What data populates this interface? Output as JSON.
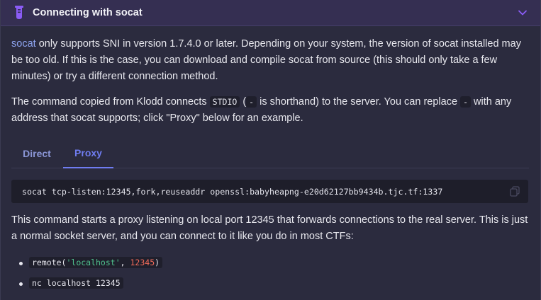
{
  "header": {
    "title": "Connecting with socat",
    "icon": "flask-icon",
    "accent": "#8b5cf6"
  },
  "intro": {
    "link_text": "socat",
    "text": " only supports SNI in version 1.7.4.0 or later. Depending on your system, the version of socat installed may be too old. If this is the case, you can download and compile socat from source (this should only take a few minutes) or try a different connection method."
  },
  "explain": {
    "part1": "The command copied from Klodd connects ",
    "code1": "STDIO",
    "part2": " (",
    "code2": "-",
    "part3": " is shorthand) to the server. You can replace ",
    "code3": "-",
    "part4": " with any address that socat supports; click \"Proxy\" below for an example."
  },
  "tabs": [
    {
      "label": "Direct",
      "active": false
    },
    {
      "label": "Proxy",
      "active": true
    }
  ],
  "command": "socat tcp-listen:12345,fork,reuseaddr openssl:babyheapng-e20d62127bb9434b.tjc.tf:1337",
  "proxy_text": "This command starts a proxy listening on local port 12345 that forwards connections to the real server. This is just a normal socket server, and you can connect to it like you do in most CTFs:",
  "bullets": {
    "remote": {
      "fn": "remote(",
      "host": "'localhost'",
      "sep": ", ",
      "port": "12345",
      "close": ")"
    },
    "nc": "nc localhost 12345"
  }
}
